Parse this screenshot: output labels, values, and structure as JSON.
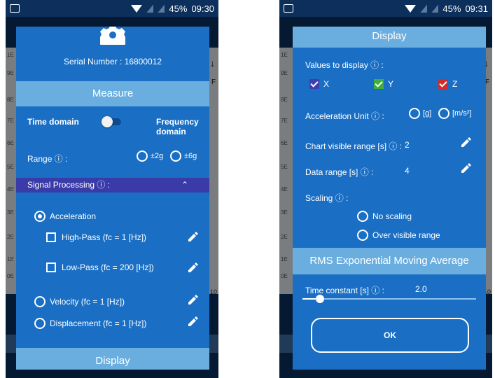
{
  "left": {
    "status": {
      "battery": "45%",
      "time": "09:30"
    },
    "background": {
      "rows": [
        "1E",
        "9E",
        "8E",
        "7E",
        "6E",
        "5E",
        "4E",
        "3E",
        "2E",
        "1E",
        "0E"
      ],
      "right_marks": [
        "↓",
        "F",
        "10"
      ]
    },
    "serial_number": "Serial Number : 16800012",
    "measure": {
      "title": "Measure",
      "time_domain": "Time domain",
      "frequency_domain": "Frequency domain",
      "time_domain_toggle_on": false,
      "range_label": "Range ⓘ :",
      "range_options": [
        "±2g",
        "±6g"
      ]
    },
    "signal_processing": {
      "title": "Signal Processing ⓘ :",
      "acceleration": "Acceleration",
      "high_pass": "High-Pass (fc = 1 [Hz])",
      "low_pass": "Low-Pass (fc = 200 [Hz])",
      "velocity": "Velocity (fc = 1 [Hz])",
      "displacement": "Displacement (fc = 1 [Hz])"
    },
    "display_footer": "Display"
  },
  "right": {
    "status": {
      "battery": "45%",
      "time": "09:31"
    },
    "background": {
      "rows": [
        "1E",
        "9E",
        "8E",
        "7E",
        "6E",
        "5E",
        "4E",
        "3E",
        "2E",
        "1E",
        "0E"
      ],
      "right_marks": [
        "↓",
        "F",
        "10"
      ]
    },
    "display": {
      "title": "Display",
      "values_to_display": "Values to display ⓘ :",
      "axes": [
        {
          "label": "X",
          "color": "#3b3fb0"
        },
        {
          "label": "Y",
          "color": "#3fae3a"
        },
        {
          "label": "Z",
          "color": "#d42a2a"
        }
      ],
      "acceleration_unit_label": "Acceleration Unit ⓘ :",
      "unit_options": [
        "[g]",
        "[m/s²]"
      ],
      "chart_visible_range_label": "Chart visible range [s] ⓘ :",
      "chart_visible_range_value": "2",
      "data_range_label": "Data range [s] ⓘ :",
      "data_range_value": "4",
      "scaling_label": "Scaling ⓘ :",
      "scaling_options": [
        "No scaling",
        "Over visible range"
      ]
    },
    "rms": {
      "title": "RMS Exponential Moving Average",
      "time_constant_label": "Time constant [s] ⓘ :",
      "time_constant_value": "2.0",
      "slider_fraction": 0.1
    },
    "ok_label": "OK"
  }
}
